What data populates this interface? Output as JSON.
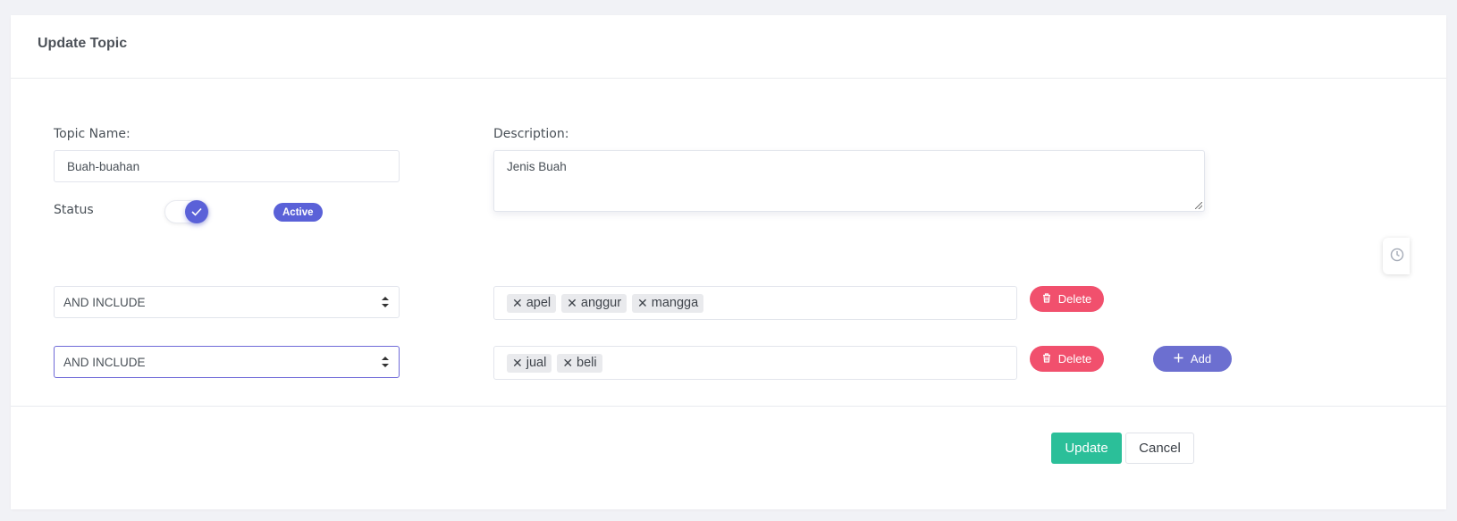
{
  "card": {
    "title": "Update Topic"
  },
  "form": {
    "topic_name_label": "Topic Name:",
    "topic_name_value": "Buah-buahan",
    "description_label": "Description:",
    "description_value": "Jenis Buah",
    "status_label": "Status",
    "status_toggle_on": true,
    "status_badge": "Active"
  },
  "rules": [
    {
      "operator": "AND INCLUDE",
      "tags": [
        "apel",
        "anggur",
        "mangga"
      ],
      "delete_label": "Delete"
    },
    {
      "operator": "AND INCLUDE",
      "tags": [
        "jual",
        "beli"
      ],
      "delete_label": "Delete"
    }
  ],
  "add_label": "Add",
  "actions": {
    "update_label": "Update",
    "cancel_label": "Cancel"
  },
  "icons": {
    "tag_remove": "times-icon",
    "delete": "trash-icon",
    "add": "plus-icon",
    "toggle_check": "check-icon",
    "side_tab": "clock-icon"
  },
  "colors": {
    "primary": "#5a61d8",
    "danger": "#f1506d",
    "add": "#6c6fd0",
    "success": "#2bbf99",
    "background": "#f1f2f6"
  }
}
